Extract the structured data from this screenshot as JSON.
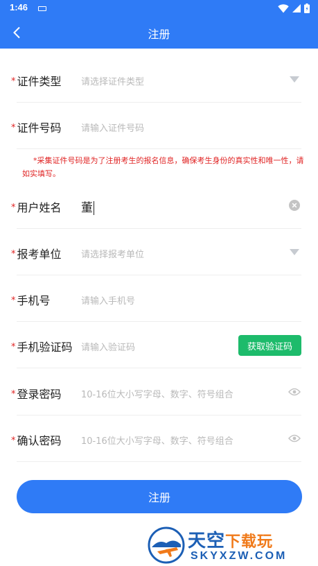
{
  "status_bar": {
    "time": "1:46"
  },
  "header": {
    "title": "注册"
  },
  "form": {
    "required_mark": "*",
    "fields": [
      {
        "label": "证件类型",
        "placeholder": "请选择证件类型",
        "value": "",
        "action": "dropdown"
      },
      {
        "label": "证件号码",
        "placeholder": "请输入证件号码",
        "value": "",
        "action": "none"
      },
      {
        "label": "用户姓名",
        "placeholder": "",
        "value": "董",
        "action": "clear"
      },
      {
        "label": "报考单位",
        "placeholder": "请选择报考单位",
        "value": "",
        "action": "dropdown"
      },
      {
        "label": "手机号",
        "placeholder": "请输入手机号",
        "value": "",
        "action": "none"
      },
      {
        "label": "手机验证码",
        "placeholder": "请输入验证码",
        "value": "",
        "action": "sms"
      },
      {
        "label": "登录密码",
        "placeholder": "10-16位大小写字母、数字、符号组合",
        "value": "",
        "action": "eye"
      },
      {
        "label": "确认密码",
        "placeholder": "10-16位大小写字母、数字、符号组合",
        "value": "",
        "action": "eye"
      }
    ],
    "id_notice": "*采集证件号码是为了注册考生的报名信息，确保考生身份的真实性和唯一性，请如实填写。",
    "sms_button_label": "获取验证码"
  },
  "submit_label": "注册",
  "watermark": {
    "cn_main": "天空",
    "cn_sub": "下载玩",
    "en": "SKYXZW.COM"
  },
  "colors": {
    "primary": "#2f7bf6",
    "sms_button": "#1dbb6b",
    "required": "#e02424",
    "placeholder": "#b9b9b9"
  }
}
